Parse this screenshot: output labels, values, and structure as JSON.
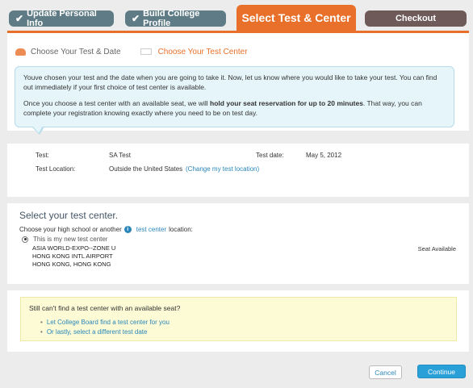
{
  "steps": {
    "step1": "Update Personal Info",
    "step2": "Build College Profile",
    "step3": "Select Test & Center",
    "step4": "Checkout",
    "check": "✔"
  },
  "substeps": {
    "first": "Choose Your Test & Date",
    "second": "Choose Your Test Center"
  },
  "info": {
    "para1": "Youve chosen your test and the date when you are going to take it. Now, let us know where you would like to take your test. You can find out immediately if your first choice of test center is available.",
    "para2_pre": "Once you choose a test center with an available seat, we will ",
    "para2_bold": "hold your seat reservation for up to 20 minutes",
    "para2_post": ". That way, you can complete your registration knowing exactly where you need to be on test day."
  },
  "details": {
    "test_label": "Test:",
    "test_value": "SA   Test",
    "date_label": "Test date:",
    "date_value": "May 5, 2012",
    "location_label": "Test Location:",
    "location_value": "Outside the United States",
    "location_link": "(Change my test location)"
  },
  "center": {
    "title": "Select your test center.",
    "choose_pre": "Choose your high school or another",
    "choose_link": "test center",
    "choose_post": "location:",
    "radio_label": "This is my new test center",
    "line1": "ASIA WORLD-EXPO--ZONE U",
    "line2": "HONG KONG INTL AIRPORT",
    "line3": "HONG KONG, HONG KONG",
    "seat_status": "Seat Available"
  },
  "help": {
    "title": "Still can't find a test center with an available seat?",
    "option1": "Let College Board find a test center for you",
    "option2": "Or lastly, select a different test date"
  },
  "actions": {
    "cancel": "Cancel",
    "continue": "Continue"
  },
  "colors": {
    "accent": "#e8702a",
    "done_step": "#5f7c86",
    "checkout_step": "#6d5a59",
    "link": "#2a86b8",
    "primary_button": "#2aa0d8"
  }
}
